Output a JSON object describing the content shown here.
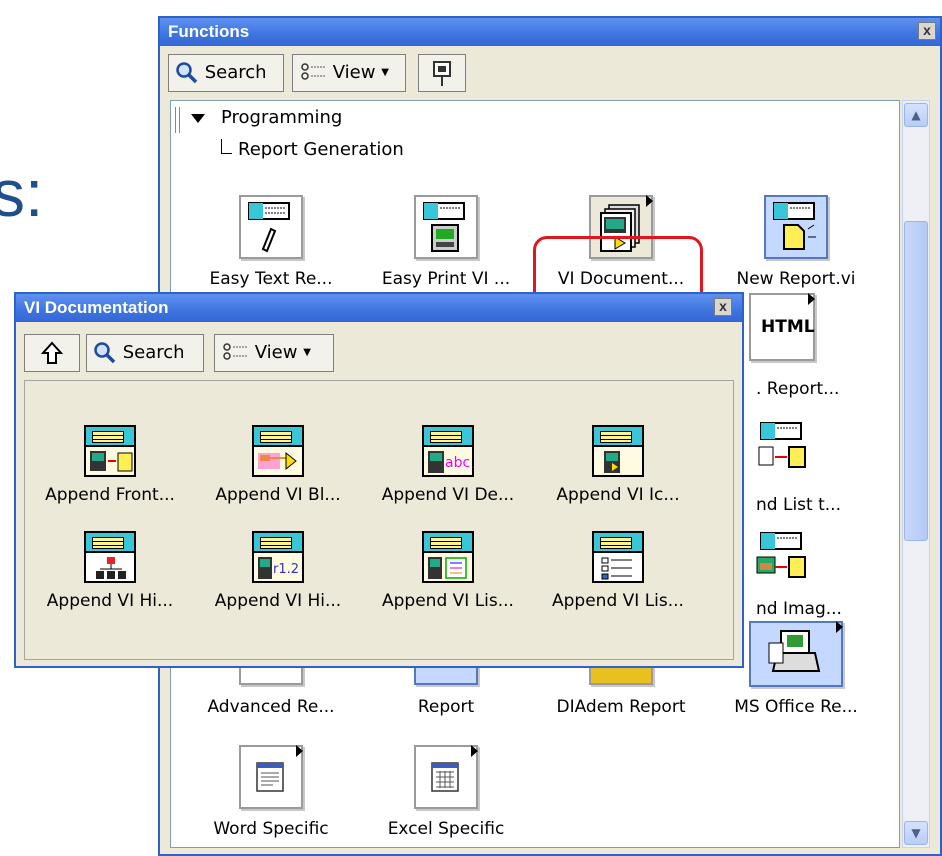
{
  "background_text": "s:",
  "functions": {
    "title": "Functions",
    "close": "x",
    "toolbar": {
      "search": "Search",
      "view": "View"
    },
    "tree": {
      "programming": "Programming",
      "report_generation": "Report Generation"
    },
    "items": [
      {
        "label": "Easy Text Re...",
        "icon": "easy-text-report-icon"
      },
      {
        "label": "Easy Print VI ...",
        "icon": "easy-print-vi-icon"
      },
      {
        "label": "VI Document...",
        "icon": "vi-documentation-icon"
      },
      {
        "label": "New Report.vi",
        "icon": "new-report-icon"
      },
      {
        "label": ". Report...",
        "icon": "html-report-icon"
      },
      {
        "label": "nd List t...",
        "icon": "append-list-icon"
      },
      {
        "label": "nd Imag...",
        "icon": "append-image-icon"
      },
      {
        "label": "Advanced Re...",
        "icon": "advanced-report-icon"
      },
      {
        "label": "Report",
        "icon": "report-icon"
      },
      {
        "label": "DIAdem Report",
        "icon": "diadem-report-icon"
      },
      {
        "label": "MS Office Re...",
        "icon": "ms-office-report-icon"
      },
      {
        "label": "Word Specific",
        "icon": "word-specific-icon"
      },
      {
        "label": "Excel Specific",
        "icon": "excel-specific-icon"
      }
    ],
    "html_label": "HTML"
  },
  "vi_doc": {
    "title": "VI Documentation",
    "close": "x",
    "toolbar": {
      "search": "Search",
      "view": "View"
    },
    "items": [
      {
        "label": "Append Front...",
        "icon": "append-front-panel-icon"
      },
      {
        "label": "Append VI Bl...",
        "icon": "append-vi-block-diagram-icon"
      },
      {
        "label": "Append VI De...",
        "icon": "append-vi-description-icon"
      },
      {
        "label": "Append VI Ic...",
        "icon": "append-vi-icon-icon"
      },
      {
        "label": "Append VI Hi...",
        "icon": "append-vi-hierarchy-icon"
      },
      {
        "label": "Append VI Hi...",
        "icon": "append-vi-history-icon"
      },
      {
        "label": "Append VI Lis...",
        "icon": "append-vi-list-icon"
      },
      {
        "label": "Append VI Lis...",
        "icon": "append-vi-list-2-icon"
      }
    ],
    "abc": "abc",
    "rev": "r1.2"
  },
  "colors": {
    "title_blue": "#3d74e0",
    "highlight_red": "#e0151d",
    "bg_text": "#1f4e8c"
  }
}
